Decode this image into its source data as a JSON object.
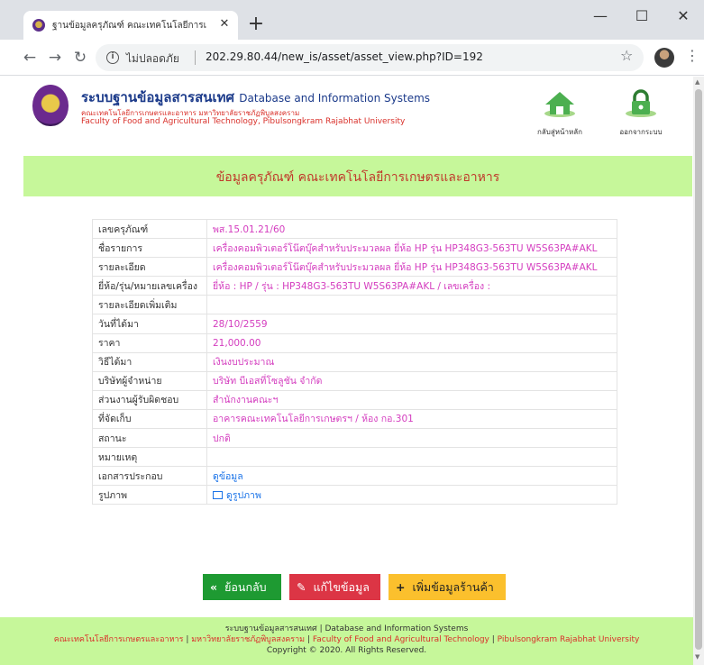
{
  "browser": {
    "tab_title": "ฐานข้อมูลครุภัณฑ์ คณะเทคโนโลยีการเ",
    "tab_close": "✕",
    "new_tab": "+",
    "minimize": "—",
    "maximize": "☐",
    "close": "✕",
    "back": "←",
    "forward": "→",
    "reload": "↻",
    "info": "i",
    "security_label": "ไม่ปลอดภัย",
    "url": "202.29.80.44/new_is/asset/asset_view.php?ID=192",
    "bookmark": "☆",
    "menu": "⋮"
  },
  "header": {
    "title_th": "ระบบฐานข้อมูลสารสนเทศ",
    "title_en": "Database and Information Systems",
    "subtitle_th": "คณะเทคโนโลยีการเกษตรและอาหาร มหาวิทยาลัยราชภัฏพิบูลสงคราม",
    "subtitle_en": "Faculty of Food and Agricultural Technology, Pibulsongkram Rajabhat University",
    "home_label": "กลับสู่หน้าหลัก",
    "logout_label": "ออกจากระบบ"
  },
  "banner": {
    "title": "ข้อมูลครุภัณฑ์ คณะเทคโนโลยีการเกษตรและอาหาร"
  },
  "details": [
    {
      "label": "เลขครุภัณฑ์",
      "value": "พส.15.01.21/60"
    },
    {
      "label": "ชื่อรายการ",
      "value": "เครื่องคอมพิวเตอร์โน๊ตบุ๊คสำหรับประมวลผล ยี่ห้อ HP รุ่น HP348G3-563TU W5S63PA#AKL"
    },
    {
      "label": "รายละเอียด",
      "value": "เครื่องคอมพิวเตอร์โน๊ตบุ๊คสำหรับประมวลผล ยี่ห้อ HP รุ่น HP348G3-563TU W5S63PA#AKL"
    },
    {
      "label": "ยี่ห้อ/รุ่น/หมายเลขเครื่อง",
      "value": "ยี่ห้อ : HP / รุ่น : HP348G3-563TU W5S63PA#AKL / เลขเครื่อง :"
    },
    {
      "label": "รายละเอียดเพิ่มเติม",
      "value": ""
    },
    {
      "label": "วันที่ได้มา",
      "value": "28/10/2559"
    },
    {
      "label": "ราคา",
      "value": "21,000.00"
    },
    {
      "label": "วิธีได้มา",
      "value": "เงินงบประมาณ"
    },
    {
      "label": "บริษัทผู้จำหน่าย",
      "value": "บริษัท บีเอสที่โซลูชัน จำกัด"
    },
    {
      "label": "ส่วนงานผู้รับผิดชอบ",
      "value": "สำนักงานคณะฯ"
    },
    {
      "label": "ที่จัดเก็บ",
      "value": "อาคารคณะเทคโนโลยีการเกษตรฯ / ห้อง กอ.301"
    },
    {
      "label": "สถานะ",
      "value": "ปกติ"
    },
    {
      "label": "หมายเหตุ",
      "value": ""
    },
    {
      "label": "เอกสารประกอบ",
      "value": "ดูข้อมูล"
    },
    {
      "label": "รูปภาพ",
      "value": "ดูรูปภาพ"
    }
  ],
  "buttons": {
    "back": "ย้อนกลับ",
    "back_icon": "«",
    "edit": "แก้ไขข้อมูล",
    "edit_icon": "✎",
    "add": "เพิ่มข้อมูลร้านค้า",
    "add_icon": "+"
  },
  "footer": {
    "line1_th": "ระบบฐานข้อมูลสารสนเทศ",
    "line1_en": "Database and Information Systems",
    "faculty_th": "คณะเทคโนโลยีการเกษตรและอาหาร",
    "university_th": "มหาวิทยาลัยราชภัฏพิบูลสงคราม",
    "faculty_en": "Faculty of Food and Agricultural Technology",
    "university_en": "Pibulsongkram Rajabhat University",
    "copyright": "Copyright © 2020. All Rights Reserved."
  },
  "colors": {
    "banner_bg": "#c6f79a",
    "value_text": "#d43dbf",
    "header_title": "#1b3a8a",
    "header_sub": "#d9302a",
    "back_button": "#1e9a32",
    "edit_button": "#dc3545",
    "add_button": "#fbc02d"
  }
}
